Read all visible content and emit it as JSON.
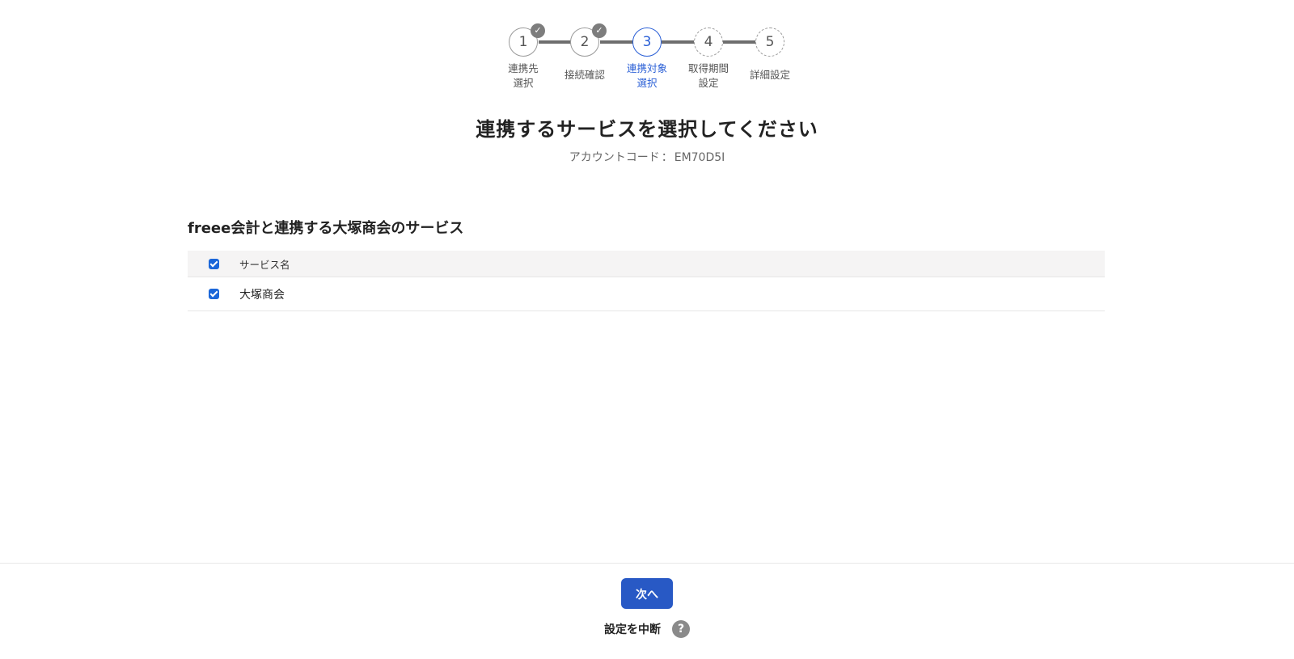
{
  "stepper": {
    "steps": [
      {
        "number": "1",
        "label": "連携先\n選択",
        "state": "done"
      },
      {
        "number": "2",
        "label": "接続確認",
        "state": "done"
      },
      {
        "number": "3",
        "label": "連携対象\n選択",
        "state": "current"
      },
      {
        "number": "4",
        "label": "取得期間\n設定",
        "state": "future"
      },
      {
        "number": "5",
        "label": "詳細設定",
        "state": "future"
      }
    ],
    "check_glyph": "✓"
  },
  "header": {
    "title": "連携するサービスを選択してください",
    "account_code_label": "アカウントコード",
    "account_code_separator": "：",
    "account_code_value": "EM70D5I"
  },
  "section": {
    "title": "freee会計と連携する大塚商会のサービス",
    "table": {
      "column_header": "サービス名",
      "header_checked": true,
      "rows": [
        {
          "name": "大塚商会",
          "checked": true
        }
      ]
    }
  },
  "footer": {
    "next_label": "次へ",
    "suspend_label": "設定を中断",
    "help_glyph": "?"
  },
  "colors": {
    "accent": "#2a5fd6",
    "button": "#2859c5",
    "checkbox": "#1a66d9"
  }
}
